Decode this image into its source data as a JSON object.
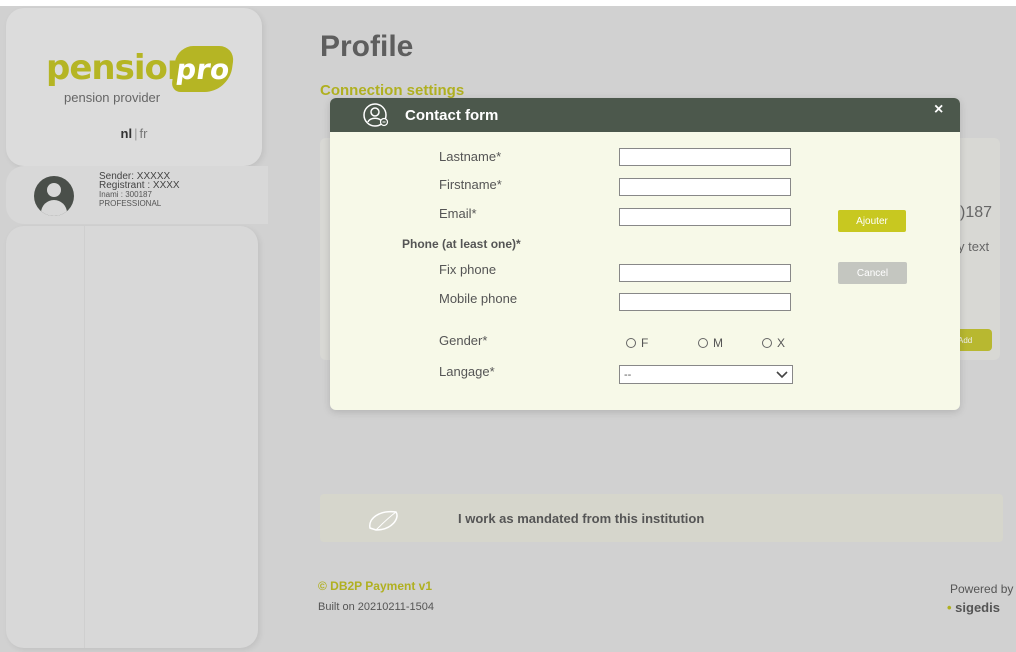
{
  "brand": {
    "logo_word": "pension",
    "logo_badge": "pro",
    "logo_sub": "pension provider"
  },
  "language": {
    "nl": "nl",
    "separator": "|",
    "fr": "fr"
  },
  "user": {
    "sender": "Sender: XXXXX",
    "registrant": "Registrant : XXXX",
    "inami": "Inami : 300187",
    "role": "PROFESSIONAL"
  },
  "page": {
    "title": "Profile",
    "section_title": "Connection settings",
    "bg_number": ")187",
    "bg_text": "y text",
    "bg_add_button": "Add"
  },
  "mandate": {
    "text": "I work as mandated from this institution"
  },
  "footer": {
    "copyright": "© DB2P Payment  v1",
    "build": "Built on 20210211-1504",
    "powered_by": "Powered by",
    "sigedis": "sigedis"
  },
  "modal": {
    "title": "Contact form",
    "close": "×",
    "lastname_label": "Lastname*",
    "lastname_value": "",
    "firstname_label": "Firstname*",
    "firstname_value": "",
    "email_label": "Email*",
    "email_value": "",
    "phone_heading": "Phone (at least one)*",
    "fix_phone_label": "Fix phone",
    "fix_phone_value": "",
    "mobile_phone_label": "Mobile phone",
    "mobile_phone_value": "",
    "gender_label": "Gender*",
    "gender_options": [
      "F",
      "M",
      "X"
    ],
    "language_label": "Langage*",
    "language_selected": "--",
    "add_button": "Ajouter",
    "cancel_button": "Cancel"
  }
}
